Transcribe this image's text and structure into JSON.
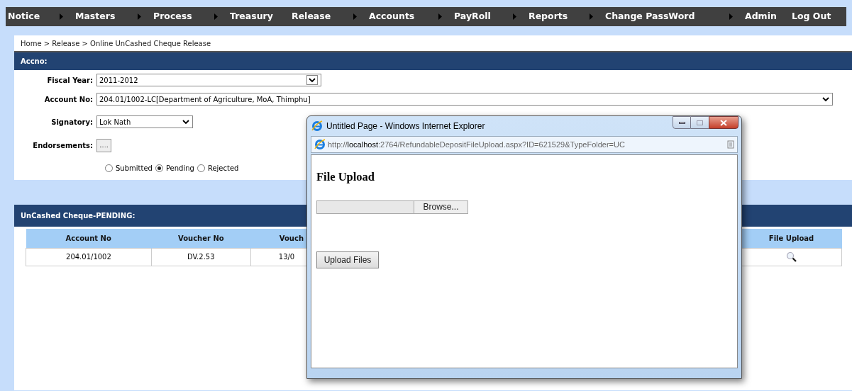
{
  "menu": [
    {
      "label": "Notice",
      "has_submenu": true
    },
    {
      "label": "Masters",
      "has_submenu": true
    },
    {
      "label": "Process",
      "has_submenu": true
    },
    {
      "label": "Treasury",
      "has_submenu": false
    },
    {
      "label": "Release",
      "has_submenu": true
    },
    {
      "label": "Accounts",
      "has_submenu": true
    },
    {
      "label": "PayRoll",
      "has_submenu": true
    },
    {
      "label": "Reports",
      "has_submenu": true
    },
    {
      "label": "Change PassWord",
      "has_submenu": true
    },
    {
      "label": "Admin",
      "has_submenu": false
    },
    {
      "label": "Log Out",
      "has_submenu": false
    }
  ],
  "breadcrumb": "Home > Release > Online UnCashed Cheque Release",
  "form_panel": {
    "title": "Accno:",
    "fiscal_year": {
      "label": "Fiscal Year:",
      "value": "2011-2012"
    },
    "account_no": {
      "label": "Account No:",
      "value": "204.01/1002-LC[Department of Agriculture, MoA, Thimphu]"
    },
    "signatory": {
      "label": "Signatory:",
      "value": "Lok Nath"
    },
    "endorsements": {
      "label": "Endorsements:",
      "button": "....."
    },
    "status_options": [
      {
        "label": "Submitted",
        "selected": false
      },
      {
        "label": "Pending",
        "selected": true
      },
      {
        "label": "Rejected",
        "selected": false
      }
    ]
  },
  "table_panel": {
    "title": "UnCashed Cheque-PENDING:",
    "columns": [
      "Account No",
      "Voucher No",
      "Vouch",
      "File Upload"
    ],
    "rows": [
      {
        "cells": [
          "204.01/1002",
          "DV.2.53",
          "13/0"
        ]
      }
    ]
  },
  "popup": {
    "title": "Untitled Page - Windows Internet Explorer",
    "url_prefix": "http://",
    "url_host": "localhost",
    "url_rest": ":2764/RefundableDepositFileUpload.aspx?ID=621529&TypeFolder=UC",
    "heading": "File Upload",
    "browse_button": "Browse...",
    "upload_button": "Upload Files"
  }
}
